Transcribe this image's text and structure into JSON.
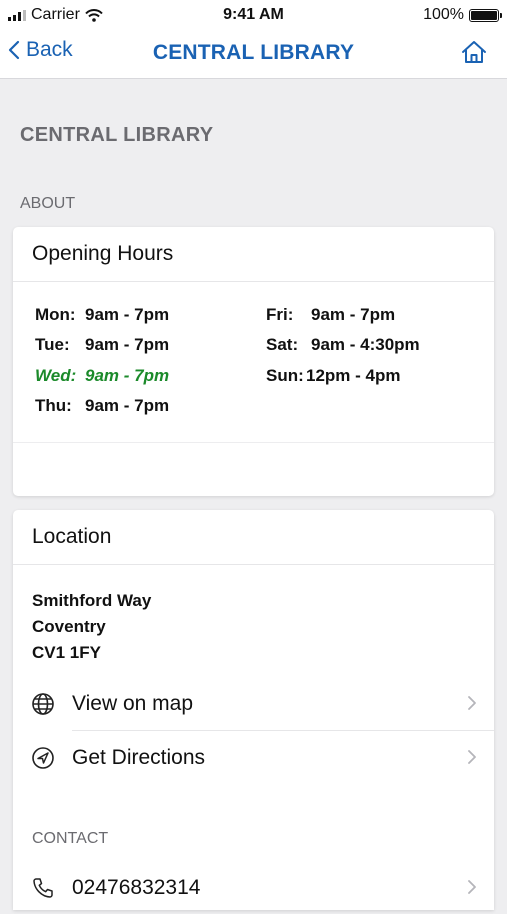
{
  "status": {
    "carrier": "Carrier",
    "time": "9:41 AM",
    "battery": "100%"
  },
  "nav": {
    "back_label": "Back",
    "title": "CENTRAL LIBRARY"
  },
  "page_title": "CENTRAL LIBRARY",
  "about_label": "ABOUT",
  "opening_hours": {
    "title": "Opening Hours",
    "left": [
      {
        "day": "Mon:",
        "time": "9am - 7pm",
        "today": false
      },
      {
        "day": "Tue:",
        "time": "9am - 7pm",
        "today": false
      },
      {
        "day": "Wed:",
        "time": "9am - 7pm",
        "today": true
      },
      {
        "day": "Thu:",
        "time": "9am - 7pm",
        "today": false
      }
    ],
    "right": [
      {
        "day": "Fri:",
        "time": "9am - 7pm"
      },
      {
        "day": "Sat:",
        "time": "9am - 4:30pm"
      },
      {
        "day": "Sun:",
        "time": "12pm - 4pm"
      }
    ]
  },
  "location": {
    "title": "Location",
    "address_line1": "Smithford Way",
    "address_line2": "Coventry",
    "address_line3": "CV1 1FY",
    "view_map_label": "View on map",
    "directions_label": "Get Directions"
  },
  "contact": {
    "label": "CONTACT",
    "phone": "02476832314"
  },
  "colors": {
    "accent": "#1a62b3",
    "today": "#1b8a2a",
    "muted": "#6b6b70"
  }
}
